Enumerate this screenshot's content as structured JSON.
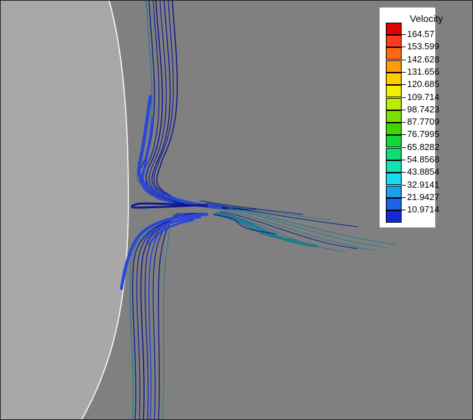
{
  "legend": {
    "title": "Velocity",
    "levels": [
      {
        "label": "164.57",
        "color": "#ff3a1a"
      },
      {
        "label": "153.599",
        "color": "#ff6a10"
      },
      {
        "label": "142.628",
        "color": "#ff9a0a"
      },
      {
        "label": "131.656",
        "color": "#ffcc00"
      },
      {
        "label": "120.685",
        "color": "#f2f000"
      },
      {
        "label": "109.714",
        "color": "#b8ec00"
      },
      {
        "label": "98.7423",
        "color": "#7ce000"
      },
      {
        "label": "87.7709",
        "color": "#3ed800"
      },
      {
        "label": "76.7995",
        "color": "#14d83a"
      },
      {
        "label": "65.8282",
        "color": "#10dc78"
      },
      {
        "label": "54.8568",
        "color": "#10e2b4"
      },
      {
        "label": "43.8854",
        "color": "#14dcec"
      },
      {
        "label": "32.9141",
        "color": "#1aa0ec"
      },
      {
        "label": "21.9427",
        "color": "#1a64ec"
      },
      {
        "label": "10.9714",
        "color": "#1428d8"
      }
    ],
    "top_color": "#e00000"
  },
  "colors": {
    "background": "#808080",
    "cylinder": "#a8a8a8",
    "cylinder_edge": "#ffffff",
    "streamline_dark": "#101a8c",
    "streamline_blue": "#2a48d8",
    "streamline_teal": "#1e7a8c"
  }
}
